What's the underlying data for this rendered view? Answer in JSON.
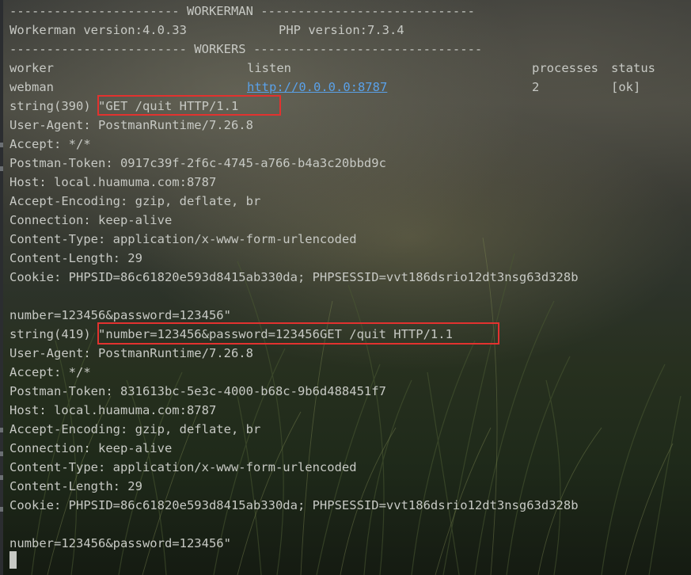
{
  "terminal": {
    "header": "----------------------- WORKERMAN -----------------------------",
    "version_workerman": "Workerman version:4.0.33",
    "version_php": "PHP version:7.3.4",
    "workers_header": "------------------------ WORKERS -------------------------------",
    "table": {
      "headers": [
        "worker",
        "listen",
        "processes",
        "status"
      ],
      "row": {
        "worker": "webman",
        "listen": "http://0.0.0.0:8787",
        "processes": "2",
        "status": "[ok]"
      }
    },
    "dump1": {
      "prefix": "string(390) ",
      "first": "\"GET /quit HTTP/1.1",
      "lines": [
        "User-Agent: PostmanRuntime/7.26.8",
        "Accept: */*",
        "Postman-Token: 0917c39f-2f6c-4745-a766-b4a3c20bbd9c",
        "Host: local.huamuma.com:8787",
        "Accept-Encoding: gzip, deflate, br",
        "Connection: keep-alive",
        "Content-Type: application/x-www-form-urlencoded",
        "Content-Length: 29",
        "Cookie: PHPSID=86c61820e593d8415ab330da; PHPSESSID=vvt186dsrio12dt3nsg63d328b"
      ],
      "body": "number=123456&password=123456\""
    },
    "dump2": {
      "prefix": "string(419) ",
      "first": "\"number=123456&password=123456GET /quit HTTP/1.1",
      "lines": [
        "User-Agent: PostmanRuntime/7.26.8",
        "Accept: */*",
        "Postman-Token: 831613bc-5e3c-4000-b68c-9b6d488451f7",
        "Host: local.huamuma.com:8787",
        "Accept-Encoding: gzip, deflate, br",
        "Connection: keep-alive",
        "Content-Type: application/x-www-form-urlencoded",
        "Content-Length: 29",
        "Cookie: PHPSID=86c61820e593d8415ab330da; PHPSESSID=vvt186dsrio12dt3nsg63d328b"
      ],
      "body": "number=123456&password=123456\""
    },
    "colors": {
      "text": "#c7c9c4",
      "link": "#5aa1e8",
      "highlight": "#e2322f"
    }
  }
}
